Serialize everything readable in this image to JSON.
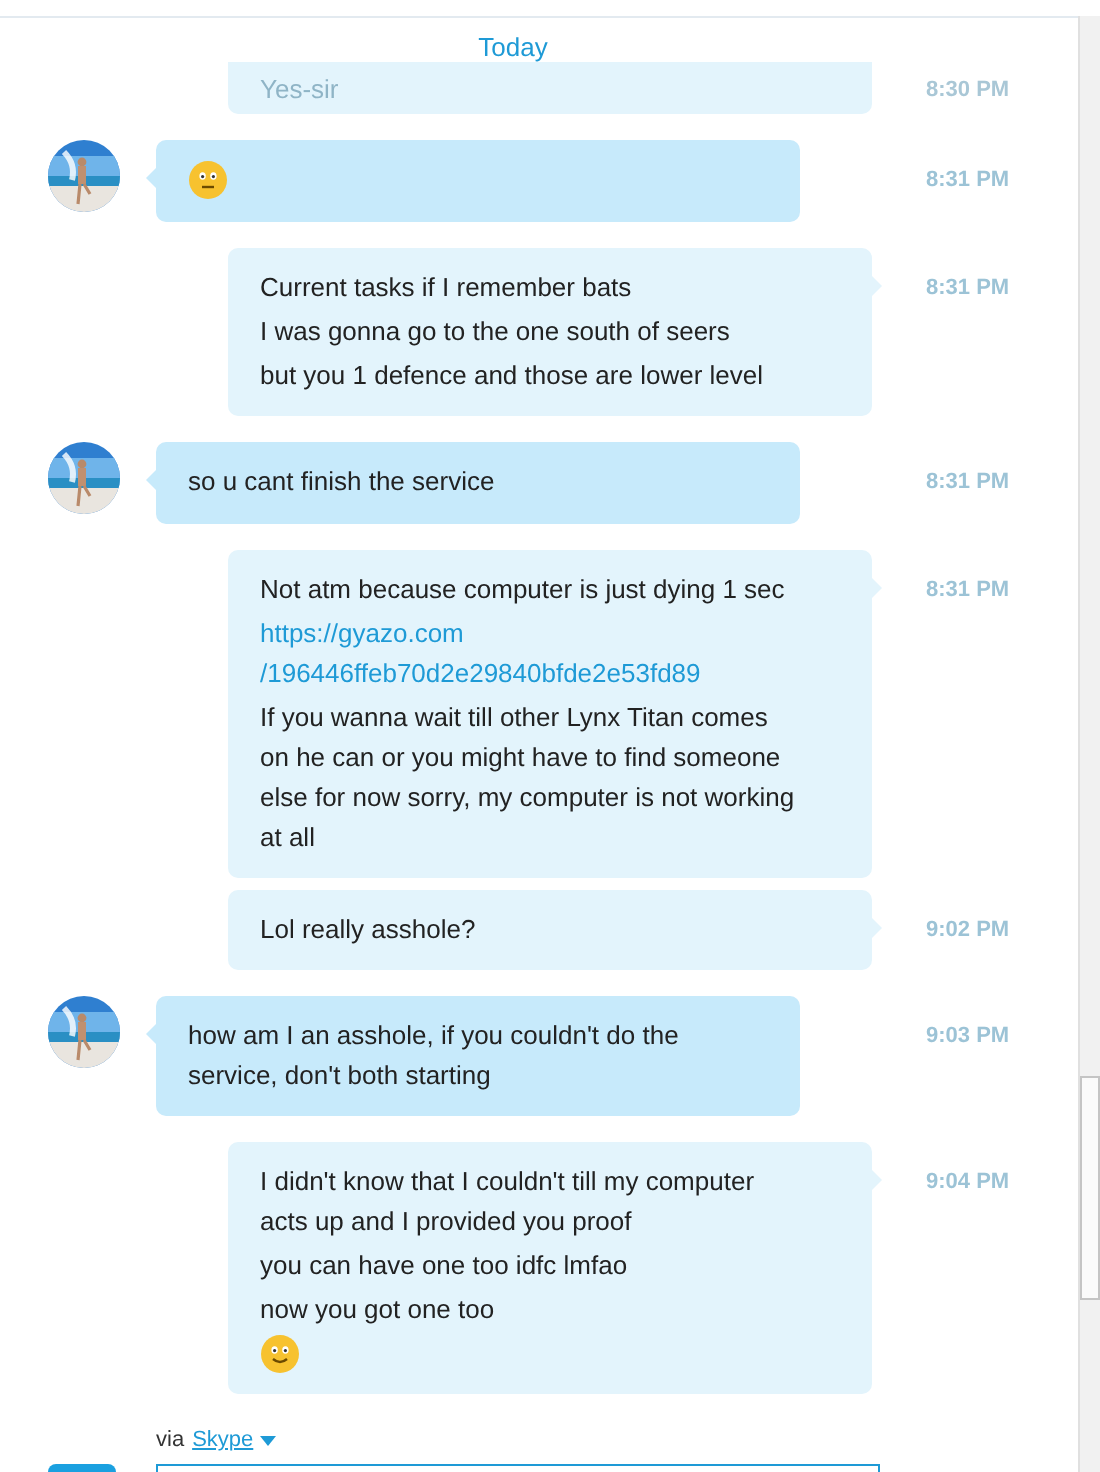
{
  "day_header": "Today",
  "previous_message": {
    "text": "Yes-sir",
    "time": "8:30 PM"
  },
  "messages": [
    {
      "kind": "incoming",
      "time": "8:31 PM",
      "parts": [
        {
          "kind": "neutral_emoji"
        }
      ]
    },
    {
      "kind": "outgoing",
      "time": "8:31 PM",
      "parts": [
        {
          "kind": "text",
          "text": "Current tasks if I remember bats"
        },
        {
          "kind": "text",
          "text": "I was gonna go to the one south of seers"
        },
        {
          "kind": "text",
          "text": "but you 1 defence and those are lower level"
        }
      ]
    },
    {
      "kind": "incoming",
      "time": "8:31 PM",
      "parts": [
        {
          "kind": "text",
          "text": "so u cant finish the service"
        }
      ]
    },
    {
      "kind": "outgoing",
      "time": "8:31 PM",
      "parts": [
        {
          "kind": "text",
          "text": "Not atm because computer is just dying 1 sec"
        },
        {
          "kind": "link",
          "text": "https://gyazo.com /196446ffeb70d2e29840bfde2e53fd89"
        },
        {
          "kind": "text",
          "text": "If you wanna wait till other Lynx Titan comes on he can or you might have to find someone else for now sorry, my computer is not working at all"
        }
      ]
    },
    {
      "kind": "outgoing",
      "time": "9:02 PM",
      "parts": [
        {
          "kind": "text",
          "text": "Lol really asshole?"
        }
      ]
    },
    {
      "kind": "incoming",
      "time": "9:03 PM",
      "parts": [
        {
          "kind": "text",
          "text": "how am I an asshole, if you couldn't do the service, don't both starting"
        }
      ]
    },
    {
      "kind": "outgoing",
      "time": "9:04 PM",
      "parts": [
        {
          "kind": "text",
          "text": "I didn't know that I couldn't till my computer acts up and I provided you proof"
        },
        {
          "kind": "text",
          "text": "you can have one too idfc lmfao"
        },
        {
          "kind": "text",
          "text": "now you got one too"
        },
        {
          "kind": "smile_emoji"
        }
      ]
    }
  ],
  "compose": {
    "via_label": "via",
    "service": "Skype"
  }
}
